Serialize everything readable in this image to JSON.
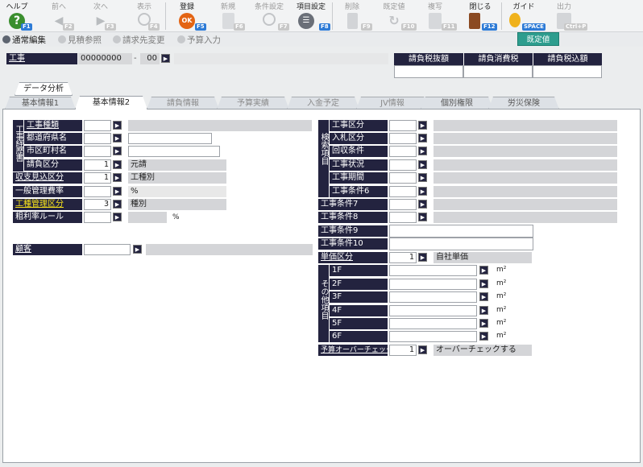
{
  "toolbar": {
    "help": {
      "label": "ヘルプ",
      "key": "F1"
    },
    "prev": {
      "label": "前へ",
      "key": "F2"
    },
    "next": {
      "label": "次へ",
      "key": "F3"
    },
    "display": {
      "label": "表示",
      "key": "F4"
    },
    "register": {
      "label": "登録",
      "key": "F5"
    },
    "new": {
      "label": "新規",
      "key": "F6"
    },
    "condition": {
      "label": "条件設定",
      "key": "F7"
    },
    "item_settings": {
      "label": "項目設定",
      "key": "F8"
    },
    "delete": {
      "label": "削除",
      "key": "F9"
    },
    "default": {
      "label": "既定値",
      "key": "F10"
    },
    "copy": {
      "label": "複写",
      "key": "F11"
    },
    "close": {
      "label": "閉じる",
      "key": "F12"
    },
    "guide": {
      "label": "ガイド",
      "key": "SPACE"
    },
    "output": {
      "label": "出力",
      "key": "Ctrl+P"
    }
  },
  "modes": {
    "normal_edit": "通常編集",
    "estimate_ref": "見積参照",
    "billing_change": "請求先変更",
    "budget_input": "予算入力"
  },
  "default_button": "既定値",
  "header": {
    "project_label": "工事",
    "project_code": "00000000",
    "project_sub": "00",
    "project_name": "",
    "columns": [
      "請負税抜額",
      "請負消費税",
      "請負税込額"
    ],
    "values": [
      "",
      "",
      ""
    ]
  },
  "data_analysis_tab": "データ分析",
  "tabs": [
    "基本情報1",
    "基本情報2",
    "請負情報",
    "予算実績",
    "入金予定",
    "JV情報",
    "個別権限",
    "労災保険"
  ],
  "active_tab": "基本情報2",
  "left_group": {
    "title": "工事経歴書",
    "rows": [
      {
        "label": "工事種類",
        "value": "",
        "text": ""
      },
      {
        "label": "都道府県名",
        "value": "",
        "text": ""
      },
      {
        "label": "市区町村名",
        "value": "",
        "text": ""
      },
      {
        "label": "請負区分",
        "value": "1",
        "text": "元請"
      }
    ]
  },
  "left_rows": [
    {
      "label": "収支見込区分",
      "value": "1",
      "text": "工種別"
    },
    {
      "label": "一般管理費率",
      "value": "",
      "text": "%"
    },
    {
      "label": "工種管理区分",
      "value": "3",
      "text": "種別"
    },
    {
      "label": "粗利率ルール",
      "value": "",
      "text": "",
      "unit": "%"
    }
  ],
  "customer": {
    "label": "顧客",
    "value": ""
  },
  "search_group": {
    "title": "検索項目",
    "rows": [
      {
        "label": "工事区分"
      },
      {
        "label": "入札区分"
      },
      {
        "label": "回収条件"
      },
      {
        "label": "工事状況"
      },
      {
        "label": "工事期間"
      },
      {
        "label": "工事条件6"
      }
    ]
  },
  "right_rows": [
    {
      "label": "工事条件7"
    },
    {
      "label": "工事条件8"
    },
    {
      "label": "工事条件9"
    },
    {
      "label": "工事条件10"
    }
  ],
  "unit_price": {
    "label": "単価区分",
    "value": "1",
    "text": "自社単価"
  },
  "other_group": {
    "title": "その他項目",
    "floors": [
      "1F",
      "2F",
      "3F",
      "4F",
      "5F",
      "6F"
    ],
    "unit": "m²"
  },
  "budget_check": {
    "label": "予算オーバーチェック",
    "value": "1",
    "text": "オーバーチェックする"
  },
  "colors": {
    "navy": "#23233f",
    "accent": "#2e7bd6",
    "teal": "#2d9d8e"
  },
  "icons": [
    "help-icon",
    "prev-arrow-icon",
    "next-arrow-icon",
    "display-magnifier-icon",
    "register-ok-icon",
    "new-document-icon",
    "condition-magnifier-icon",
    "item-settings-icon",
    "delete-trash-icon",
    "default-refresh-icon",
    "copy-icon",
    "close-door-icon",
    "guide-bulb-icon",
    "output-printer-icon"
  ]
}
